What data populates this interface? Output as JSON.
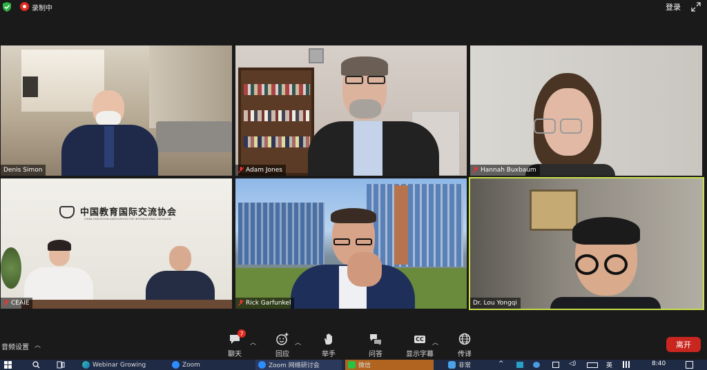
{
  "topbar": {
    "recording_label": "录制中",
    "login_label": "登录"
  },
  "participants": [
    {
      "name": "Denis Simon",
      "muted": false
    },
    {
      "name": "Adam Jones",
      "muted": true
    },
    {
      "name": "Hannah Buxbaum",
      "muted": true
    },
    {
      "name": "CEAIE",
      "muted": true,
      "banner_cn": "中国教育国际交流协会",
      "banner_en": "CHINA EDUCATION ASSOCIATION FOR INTERNATIONAL EXCHANGE"
    },
    {
      "name": "Rick Garfunkel",
      "muted": true
    },
    {
      "name": "Dr. Lou Yongqi",
      "muted": false,
      "active_speaker": true
    }
  ],
  "toolbar": {
    "audio_settings": "音频设置",
    "chat": "聊天",
    "chat_badge": "7",
    "react": "回应",
    "raise_hand": "举手",
    "qa": "问答",
    "captions": "显示字幕",
    "captions_icon": "CC",
    "interpret": "传译",
    "leave": "离开"
  },
  "taskbar": {
    "items": [
      "Webinar Growing",
      "Zoom",
      "Zoom 网络研讨会",
      "微信"
    ],
    "weather": "非常",
    "ime": "英",
    "time": "8:40"
  },
  "colors": {
    "active_border": "#c8e04a",
    "leave": "#c8261f",
    "badge": "#e02b20"
  }
}
